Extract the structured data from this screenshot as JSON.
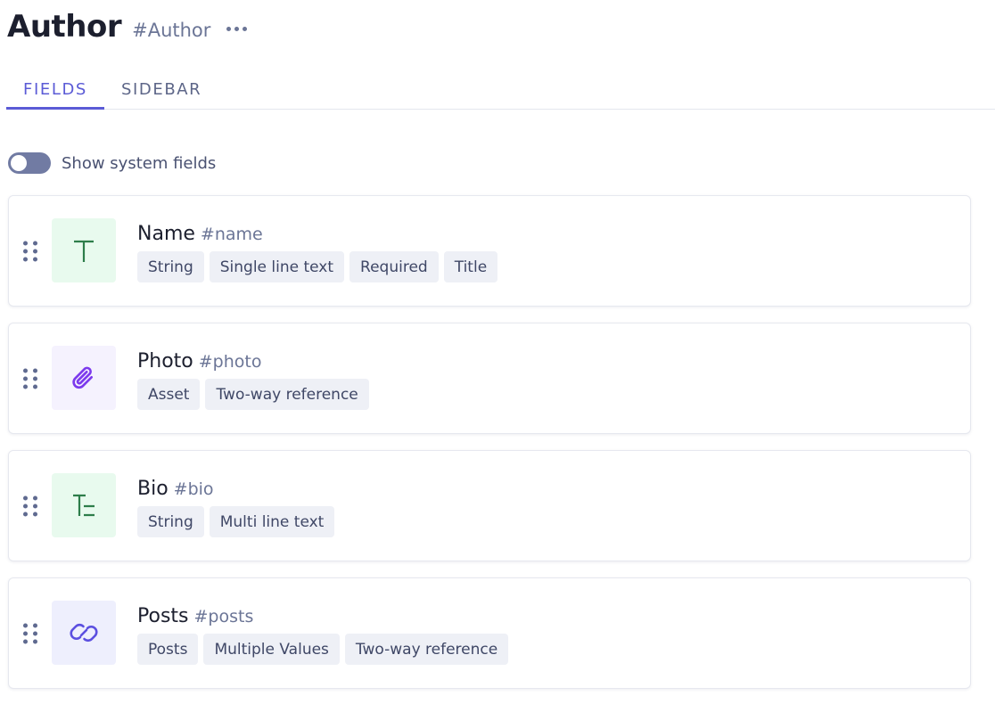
{
  "header": {
    "title": "Author",
    "api_id": "#Author",
    "more_icon": "more-horizontal-icon"
  },
  "tabs": [
    {
      "label": "FIELDS",
      "active": true
    },
    {
      "label": "SIDEBAR",
      "active": false
    }
  ],
  "system_fields_toggle": {
    "label": "Show system fields",
    "on": false
  },
  "fields": [
    {
      "name": "Name",
      "api_id": "#name",
      "icon": "text-type-icon",
      "tags": [
        "String",
        "Single line text",
        "Required",
        "Title"
      ]
    },
    {
      "name": "Photo",
      "api_id": "#photo",
      "icon": "paperclip-icon",
      "tags": [
        "Asset",
        "Two-way reference"
      ]
    },
    {
      "name": "Bio",
      "api_id": "#bio",
      "icon": "multiline-text-icon",
      "tags": [
        "String",
        "Multi line text"
      ]
    },
    {
      "name": "Posts",
      "api_id": "#posts",
      "icon": "link-icon",
      "tags": [
        "Posts",
        "Multiple Values",
        "Two-way reference"
      ]
    }
  ],
  "colors": {
    "accent": "#5b5bd6",
    "text_green": "#2d7d4a",
    "icon_purple": "#7c3aed",
    "icon_indigo": "#5b4fe0"
  }
}
